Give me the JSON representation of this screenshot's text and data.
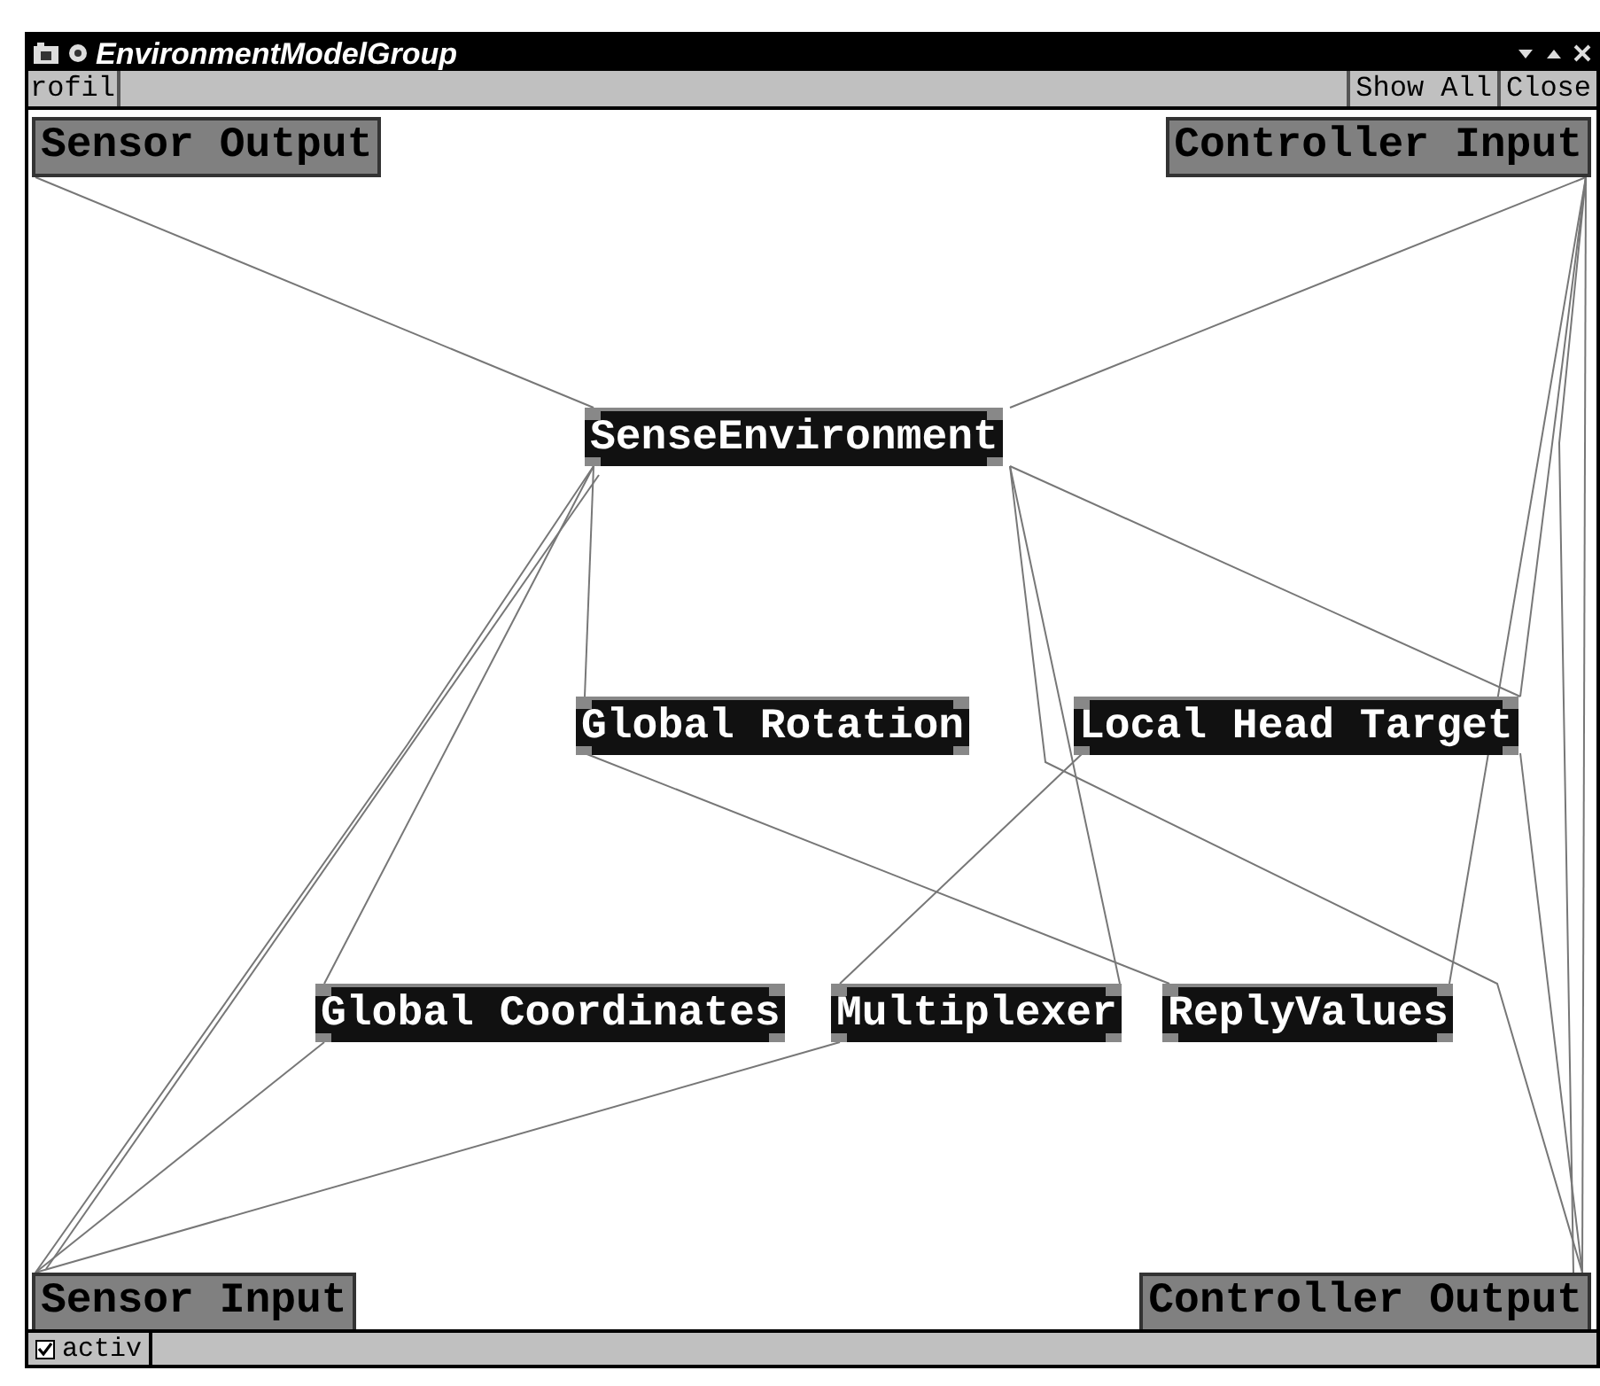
{
  "window": {
    "title": "EnvironmentModelGroup"
  },
  "toolbar": {
    "profile_button": "rofil",
    "buttons": [
      "Show All",
      "Close"
    ]
  },
  "canvas": {
    "nodes": [
      {
        "label": "Sensor Output",
        "kind": "io"
      },
      {
        "label": "Controller Input",
        "kind": "io"
      },
      {
        "label": "SenseEnvironment",
        "kind": "module"
      },
      {
        "label": "Global Rotation",
        "kind": "module"
      },
      {
        "label": "Local Head Target",
        "kind": "module"
      },
      {
        "label": "Global Coordinates",
        "kind": "module"
      },
      {
        "label": "Multiplexer",
        "kind": "module"
      },
      {
        "label": "ReplyValues",
        "kind": "module"
      },
      {
        "label": "Sensor Input",
        "kind": "io"
      },
      {
        "label": "Controller Output",
        "kind": "io"
      }
    ]
  },
  "status_bar": {
    "checkbox": {
      "label": "activ",
      "checked": true
    }
  }
}
